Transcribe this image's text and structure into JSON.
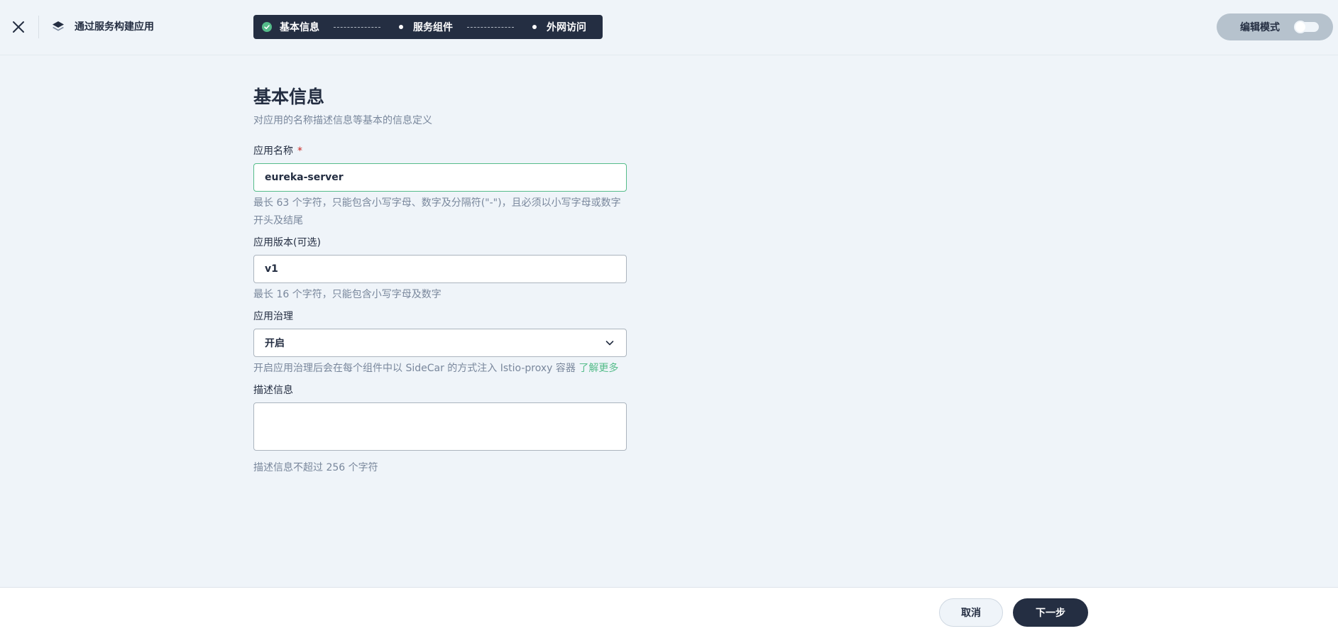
{
  "header": {
    "title": "通过服务构建应用",
    "close_icon": "close-icon",
    "app_icon": "layers-icon"
  },
  "steps": [
    {
      "label": "基本信息",
      "status": "done"
    },
    {
      "label": "服务组件",
      "status": "pending"
    },
    {
      "label": "外网访问",
      "status": "pending"
    }
  ],
  "edit_mode": {
    "label": "编辑模式",
    "enabled": false
  },
  "form": {
    "title": "基本信息",
    "description": "对应用的名称描述信息等基本的信息定义",
    "name": {
      "label": "应用名称",
      "required_mark": "*",
      "value": "eureka-server",
      "hint": "最长 63 个字符，只能包含小写字母、数字及分隔符(\"-\")，且必须以小写字母或数字开头及结尾"
    },
    "version": {
      "label": "应用版本(可选)",
      "value": "v1",
      "hint": "最长 16 个字符，只能包含小写字母及数字"
    },
    "governance": {
      "label": "应用治理",
      "value": "开启",
      "hint": "开启应用治理后会在每个组件中以 SideCar 的方式注入 Istio-proxy 容器",
      "link": "了解更多"
    },
    "desc": {
      "label": "描述信息",
      "value": "",
      "hint": "描述信息不超过 256 个字符"
    }
  },
  "footer": {
    "cancel_label": "取消",
    "next_label": "下一步"
  },
  "colors": {
    "primary_dark": "#242e42",
    "accent_green": "#55bc8a",
    "background": "#eff4f9",
    "hint_text": "#79879c",
    "required_red": "#ca2621"
  }
}
